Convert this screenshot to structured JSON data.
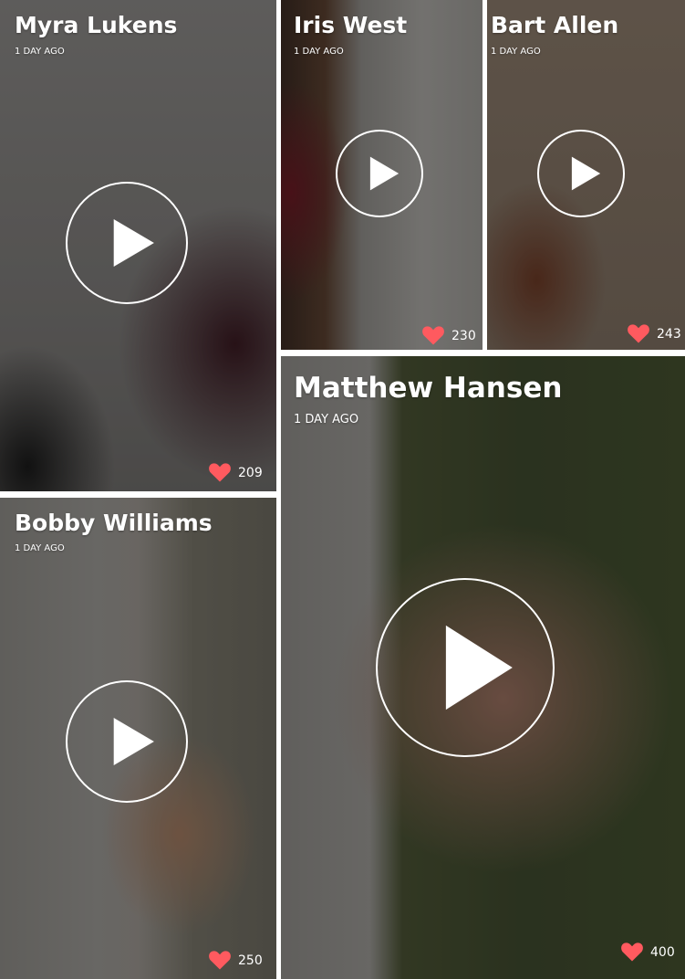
{
  "feed": {
    "cards": [
      {
        "name": "Myra Lukens",
        "time": "1 DAY AGO",
        "likes": "209"
      },
      {
        "name": "Iris West",
        "time": "1 DAY AGO",
        "likes": "230"
      },
      {
        "name": "Bart Allen",
        "time": "1 DAY AGO",
        "likes": "243"
      },
      {
        "name": "Bobby Williams",
        "time": "1 DAY AGO",
        "likes": "250"
      },
      {
        "name": "Matthew Hansen",
        "time": "1 DAY AGO",
        "likes": "400"
      }
    ]
  },
  "icons": {
    "play": "play-icon",
    "like": "heart-icon"
  },
  "colors": {
    "heart": "#ff5a5f",
    "overlay_text": "#ffffff"
  }
}
